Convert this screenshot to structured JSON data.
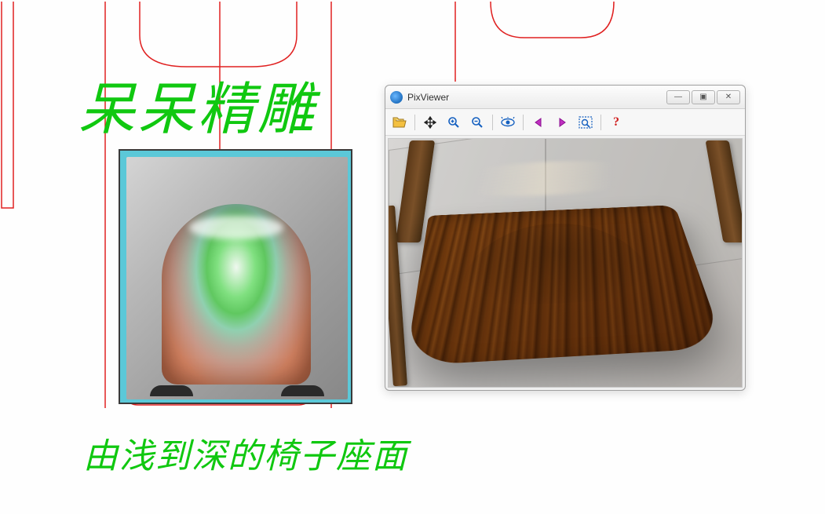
{
  "cad": {
    "title_overlay": "呆呆精雕",
    "caption_overlay": "由浅到深的椅子座面"
  },
  "pixviewer": {
    "title": "PixViewer",
    "icons": {
      "open": "open-folder-icon",
      "pan": "move-icon",
      "zoom_in": "zoom-in-icon",
      "zoom_out": "zoom-out-icon",
      "eye": "eye-icon",
      "prev": "arrow-left-icon",
      "next": "arrow-right-icon",
      "fit": "zoom-fit-icon",
      "help": "help-icon"
    },
    "window_controls": {
      "minimize": "—",
      "maximize": "▣",
      "close": "✕"
    }
  }
}
